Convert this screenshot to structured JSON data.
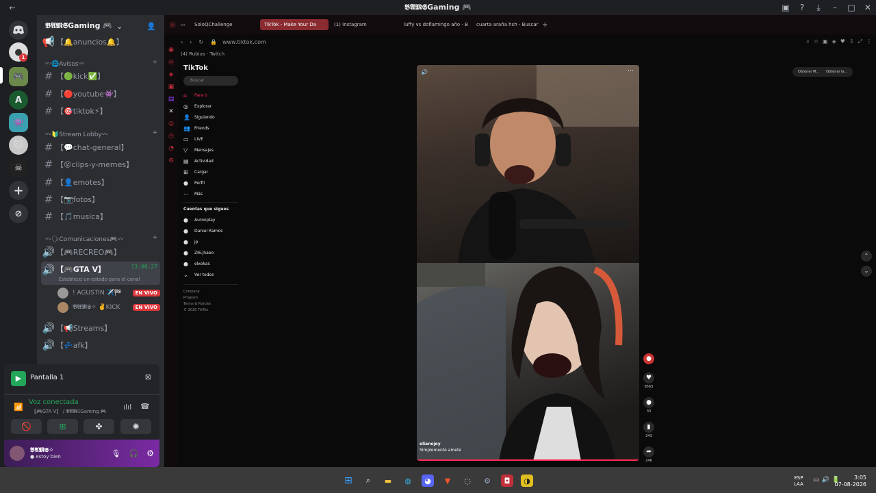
{
  "window": {
    "title": "𝕭𝕬𝕸𝕾Gaming 🎮"
  },
  "server": {
    "name": "𝕭𝕬𝕸𝕾Gaming 🎮",
    "dm_badge": "1"
  },
  "channels": {
    "top": "【🔔anuncios🔔】",
    "cat_avisos": "〰🌐Avisos〰",
    "avisos": [
      "【🟢kick✅】",
      "【🔴youtube👾】",
      "【🎯tiktok⚡】"
    ],
    "cat_stream": "〰🔰Stream Lobby〰",
    "stream": [
      "【💬chat-general】",
      "【😵clips-y-memes】",
      "【👤emotes】",
      "【📷fotos】",
      "【🎵musica】"
    ],
    "cat_com": "〰🗣Comunicaciones🎮〰",
    "voice_recreo": "【🎮RECREO🎮】",
    "voice_gta": "【🎮GTA V】",
    "voice_timer": "13:00:27",
    "voice_status": "Establece un estado para el canal",
    "voice_users": [
      "! AGUSTIN ✈️🏁",
      "𝕭𝕬𝕸𝕾✧ ✌️KICK"
    ],
    "live_label": "EN VIVO",
    "voice_streams": "【📢Streams】",
    "voice_afk": "【💤afk】"
  },
  "panel": {
    "screen": "Pantalla 1",
    "voice_status": "Voz conectada",
    "voice_channel": "【🎮GTA V】 / 𝕭𝕬𝕸𝕾Gaming 🎮"
  },
  "user": {
    "name": "𝕭𝕬𝕸𝕾✧",
    "status": "● estoy bien"
  },
  "browser": {
    "tabs": [
      "SoloQChallenge",
      "TikTok - Make Your Da",
      "(1) Instagram",
      "luffy vs doflamingo año - B",
      "cuarta araña hsh - Buscar"
    ],
    "url": "www.tiktok.com",
    "bookmarks": "(4) Rubius · Twitch",
    "extensions": [
      "Obtener M...",
      "Obtener la..."
    ]
  },
  "tiktok": {
    "logo": "TikTok",
    "search": "Buscar",
    "nav": [
      "Para ti",
      "Explorar",
      "Siguiendo",
      "Friends",
      "LIVE",
      "Mensajes",
      "Actividad",
      "Cargar",
      "Perfil",
      "Más"
    ],
    "following_label": "Cuentas que sigues",
    "following": [
      "Auronplay",
      "Daniel Ramos",
      "jp",
      "ZI6.jhaeo",
      "elxokas"
    ],
    "see_all": "Ver todos",
    "footer": [
      "Company",
      "Program",
      "Terms & Policies",
      "© 2026 TikTok"
    ],
    "caption_user": "elianojey",
    "caption_text": "Simplemente amete",
    "likes": "9563",
    "comments": "33",
    "saves": "243",
    "shares": "246"
  },
  "tray": {
    "lang": "ESP",
    "layout": "LAA",
    "time": "3:05",
    "date": "07-08-2026"
  }
}
